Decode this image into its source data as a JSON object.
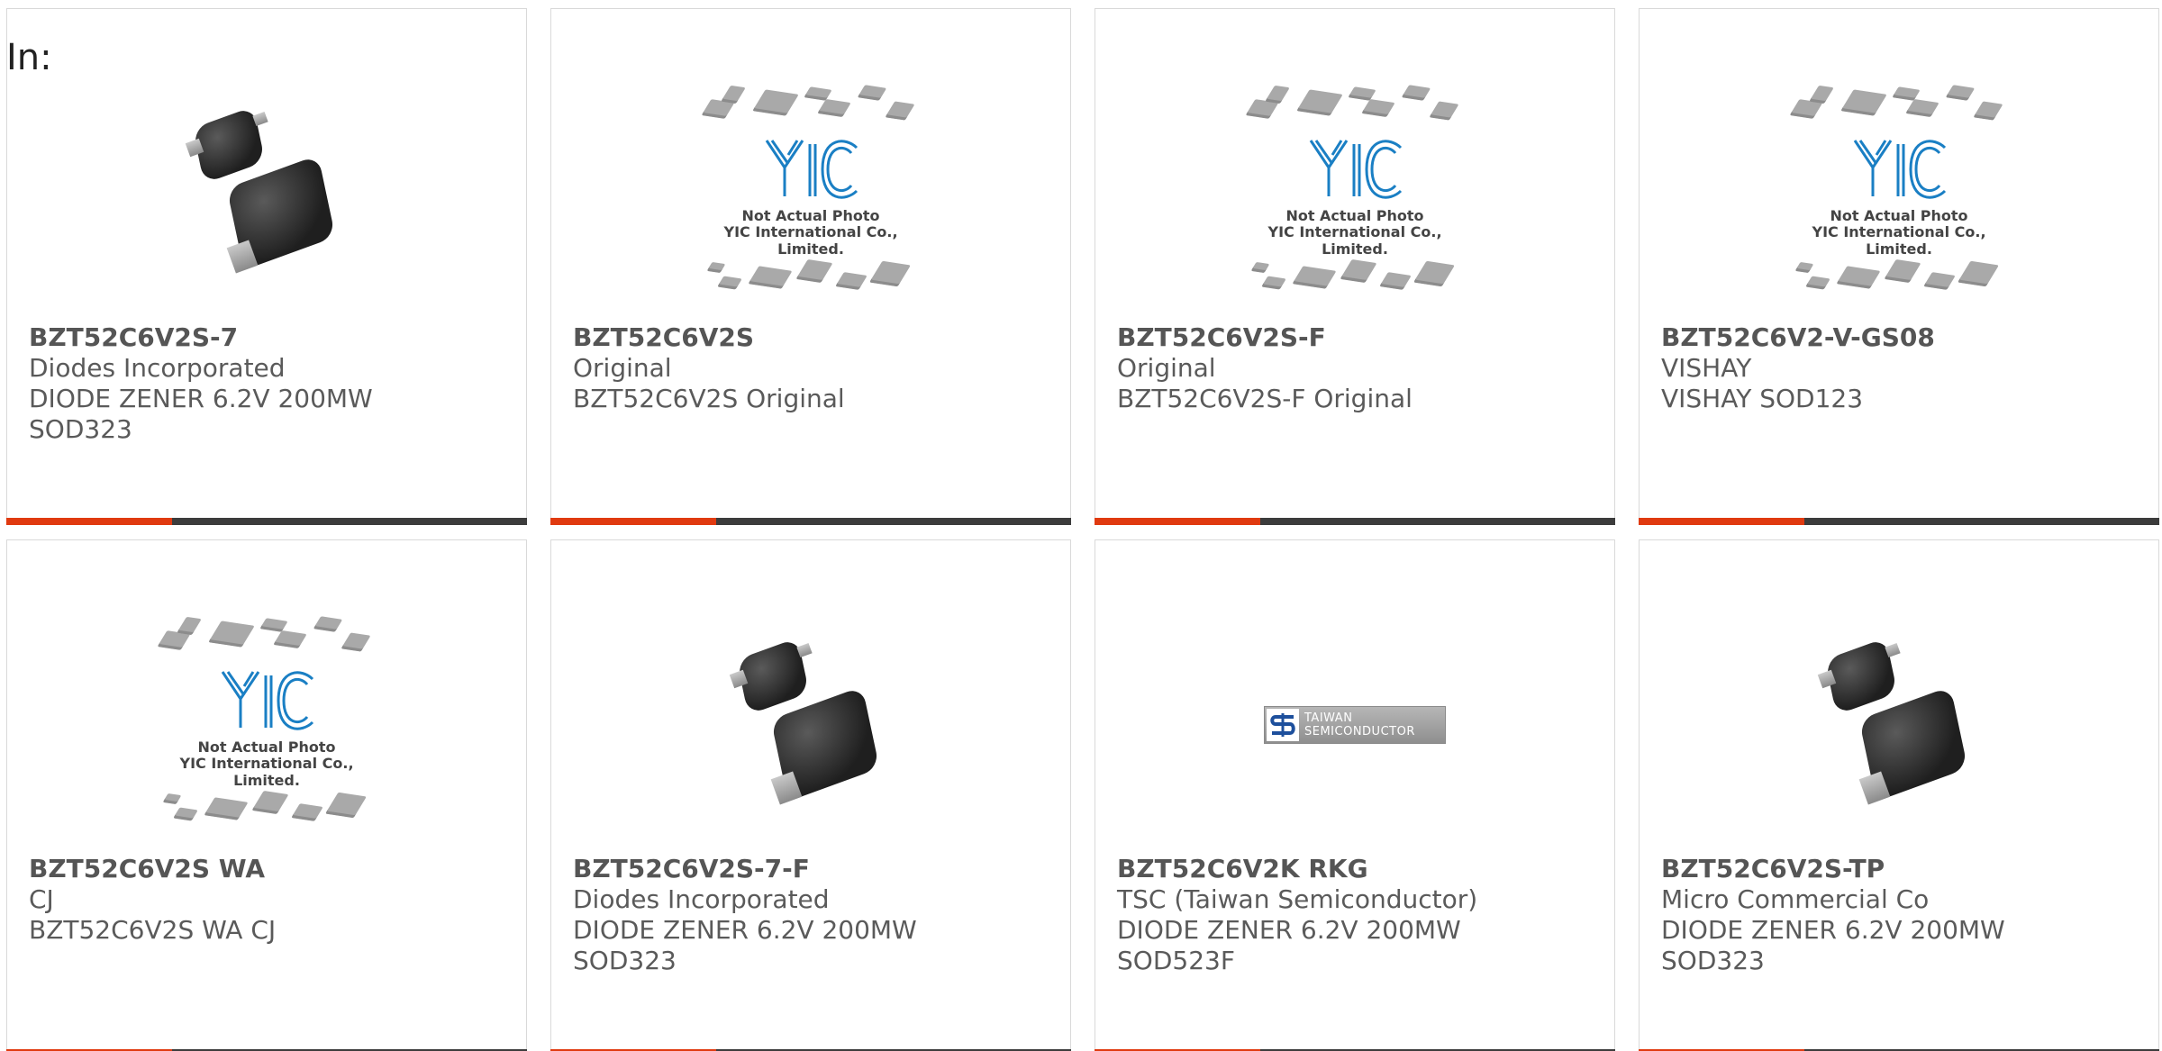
{
  "filter_label": "In:",
  "colors": {
    "accent": "#e03a10",
    "bar": "#3c3c3c",
    "text": "#5a5a5a",
    "border": "#d9d9d9"
  },
  "placeholder": {
    "caption1": "Not Actual Photo",
    "caption2": "YIC International Co., Limited."
  },
  "tsc_logo": {
    "line1": "TAIWAN",
    "line2": "SEMICONDUCTOR"
  },
  "products": [
    {
      "part_number": "BZT52C6V2S-7",
      "manufacturer": "Diodes Incorporated",
      "desc1": "DIODE ZENER 6.2V 200MW",
      "desc2": "SOD323",
      "image": "diode-photo"
    },
    {
      "part_number": "BZT52C6V2S",
      "manufacturer": "Original",
      "desc1": "BZT52C6V2S Original",
      "desc2": "",
      "image": "yic-placeholder"
    },
    {
      "part_number": "BZT52C6V2S-F",
      "manufacturer": "Original",
      "desc1": "BZT52C6V2S-F Original",
      "desc2": "",
      "image": "yic-placeholder"
    },
    {
      "part_number": "BZT52C6V2-V-GS08",
      "manufacturer": "VISHAY",
      "desc1": "VISHAY SOD123",
      "desc2": "",
      "image": "yic-placeholder"
    },
    {
      "part_number": "BZT52C6V2S WA",
      "manufacturer": "CJ",
      "desc1": "BZT52C6V2S WA CJ",
      "desc2": "",
      "image": "yic-placeholder"
    },
    {
      "part_number": "BZT52C6V2S-7-F",
      "manufacturer": "Diodes Incorporated",
      "desc1": "DIODE ZENER 6.2V 200MW",
      "desc2": "SOD323",
      "image": "diode-photo"
    },
    {
      "part_number": "BZT52C6V2K RKG",
      "manufacturer": "TSC (Taiwan Semiconductor)",
      "desc1": "DIODE ZENER 6.2V 200MW",
      "desc2": "SOD523F",
      "image": "tsc-logo"
    },
    {
      "part_number": "BZT52C6V2S-TP",
      "manufacturer": "Micro Commercial Co",
      "desc1": "DIODE ZENER 6.2V 200MW",
      "desc2": "SOD323",
      "image": "diode-photo"
    }
  ]
}
